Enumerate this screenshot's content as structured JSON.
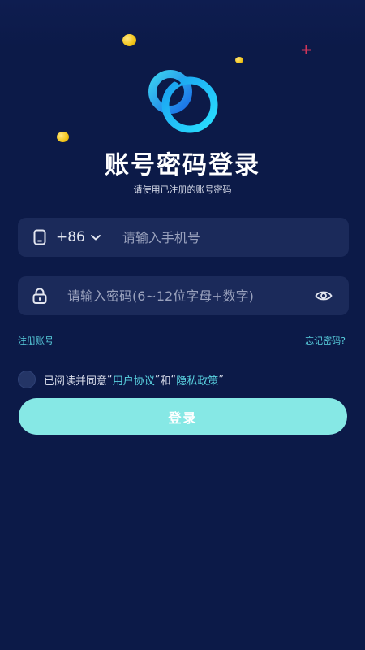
{
  "header": {
    "title": "账号密码登录",
    "subtitle": "请使用已注册的账号密码"
  },
  "phone_field": {
    "country_code": "+86",
    "placeholder": "请输入手机号",
    "value": ""
  },
  "password_field": {
    "placeholder": "请输入密码(6~12位字母+数字)",
    "value": ""
  },
  "links": {
    "register": "注册账号",
    "forgot": "忘记密码?"
  },
  "agreement": {
    "prefix": "已阅读并同意",
    "quote_open_1": "“",
    "user_agreement": "用户协议",
    "quote_close_1": "”",
    "and": "和",
    "quote_open_2": "“",
    "privacy_policy": "隐私政策",
    "quote_close_2": "”",
    "checked": false
  },
  "login_button": {
    "label": "登录"
  },
  "colors": {
    "background": "#0c1a48",
    "field_bg": "#1b2a5a",
    "accent": "#5ad2e0",
    "button": "#86e8e5"
  },
  "icons": [
    "phone-icon",
    "chevron-down-icon",
    "lock-icon",
    "eye-icon",
    "logo-icon"
  ]
}
